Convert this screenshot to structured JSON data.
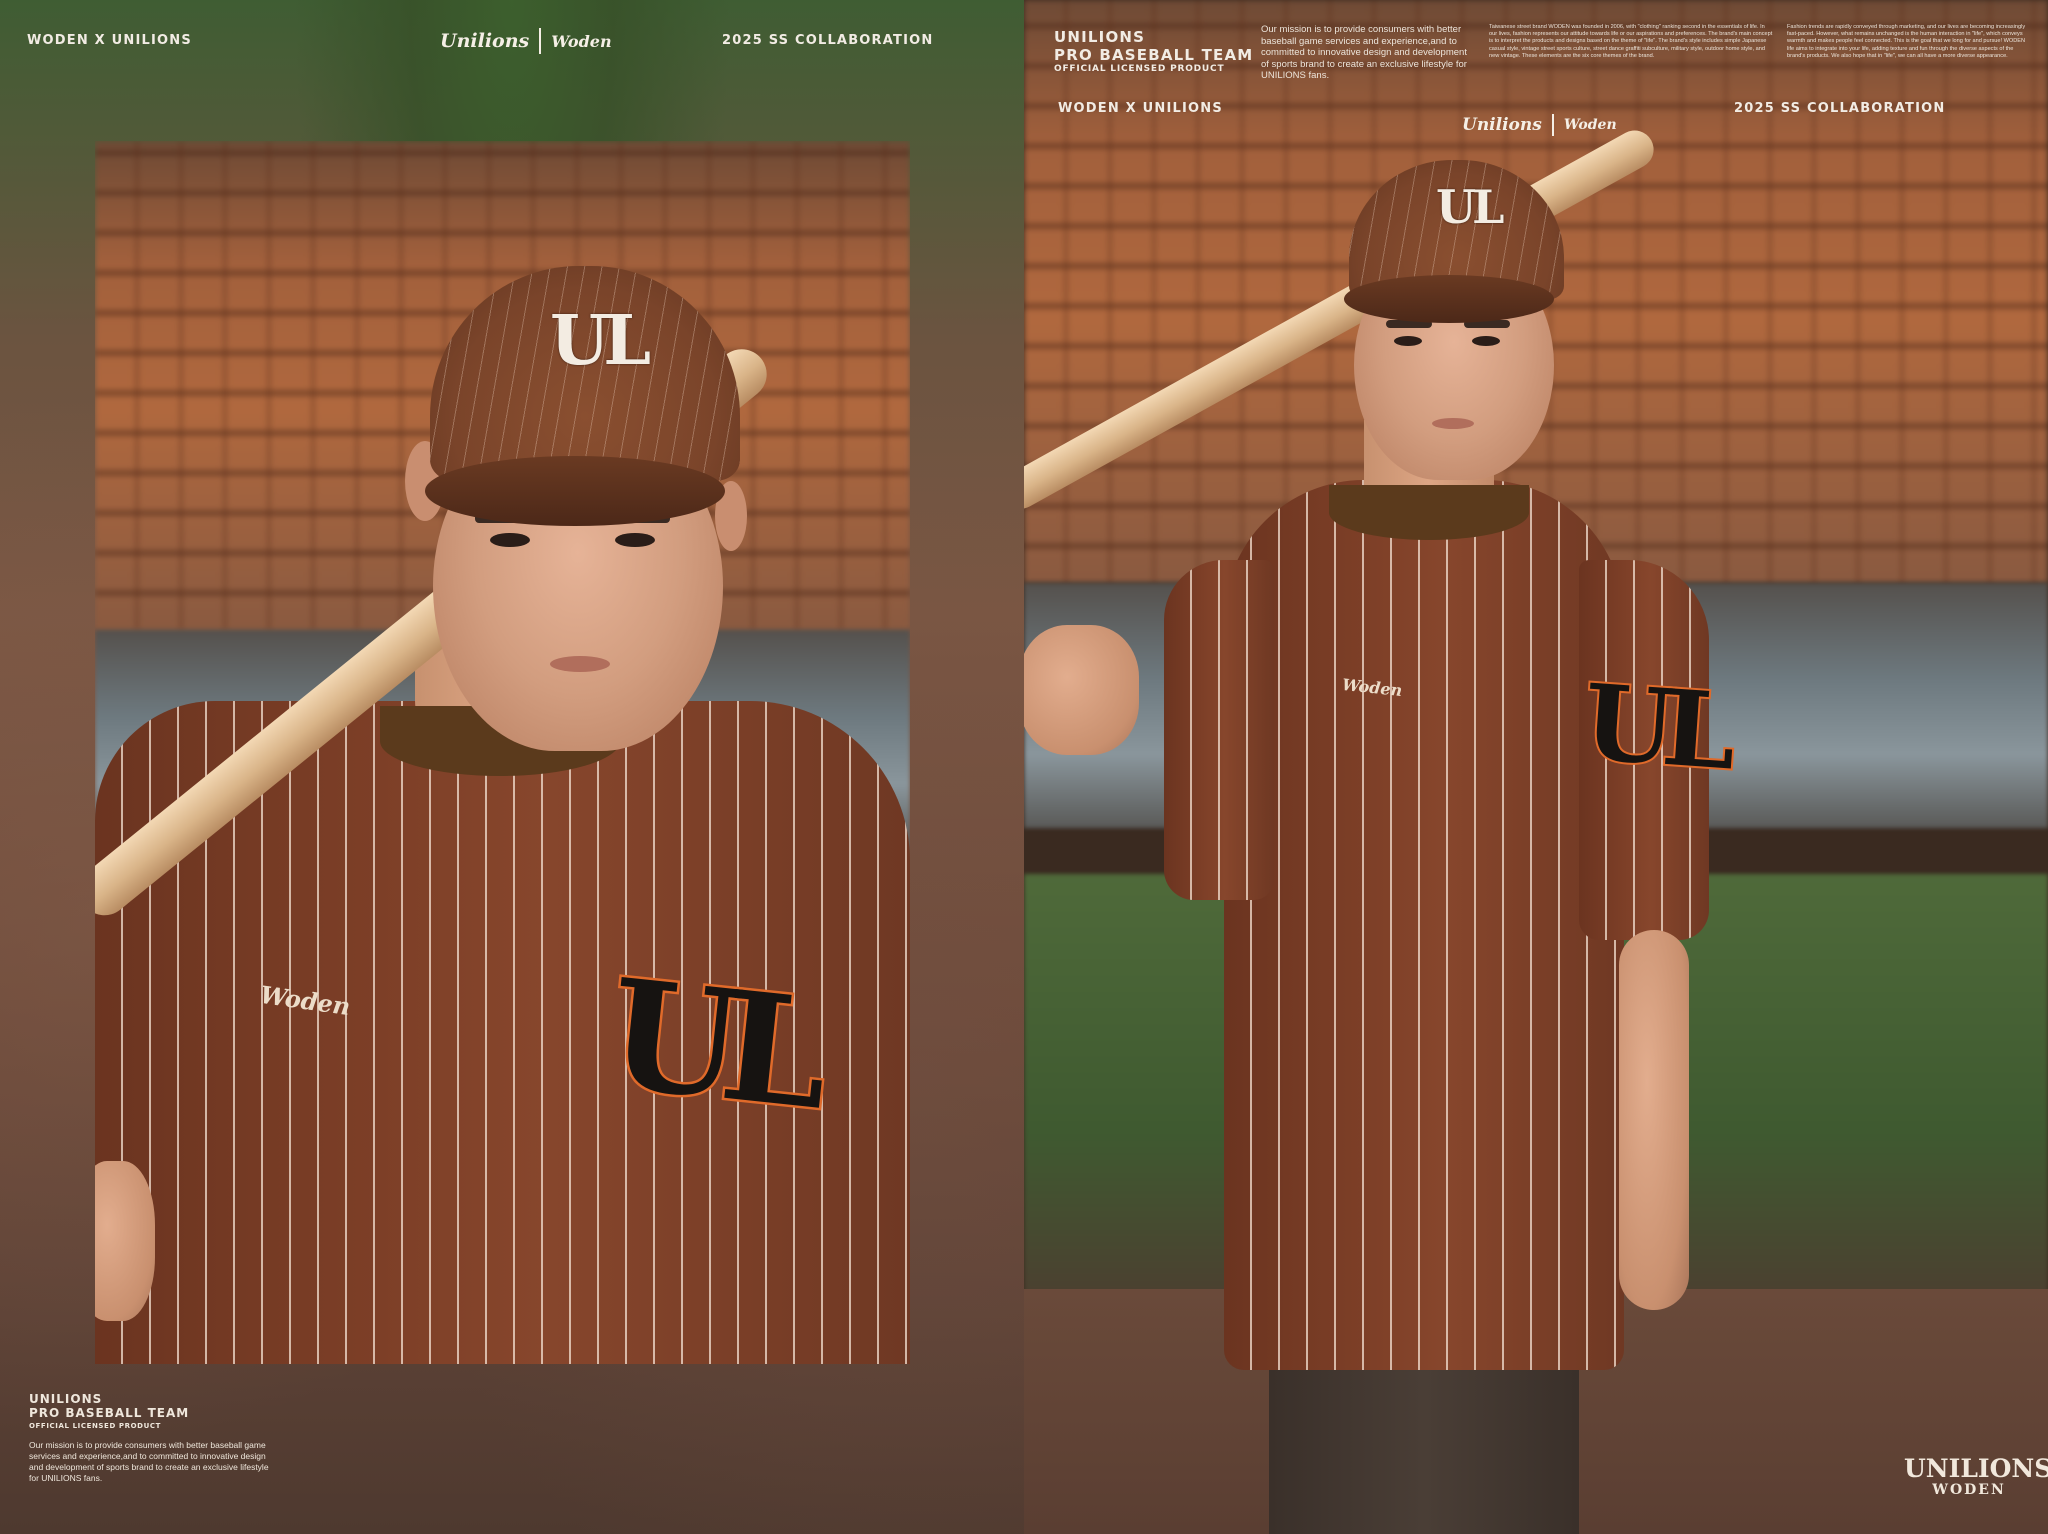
{
  "header": {
    "left": "WODEN X UNILIONS",
    "right": "2025 SS COLLABORATION",
    "logo_unilions": "Unilions",
    "logo_woden": "Woden"
  },
  "team": {
    "line1": "UNILIONS",
    "line2": "PRO BASEBALL TEAM",
    "line3": "OFFICIAL LICENSED PRODUCT"
  },
  "mission": "Our  mission is  to  provide consumers with better baseball game services  and  experience,and  to committed to innovative design and development of sports brand to  create an exclusive lifestyle for UNILIONS fans.",
  "col2": "Taiwanese street brand WODEN was founded in 2006, with \"clothing\" ranking second in the essentials of life. In our lives, fashion represents our attitude towards life or our aspirations and preferences. The brand's main concept is to interpret the products and designs based on the theme of \"life\". The brand's style includes simple Japanese casual style, vintage street sports culture, street dance graffiti subculture, military style, outdoor home style, and new vintage. These elements are the six core themes of the brand.",
  "col3": "Fashion trends are rapidly conveyed through marketing, and our lives are becoming increasingly fast-paced. However, what remains unchanged is the human interaction in \"life\", which conveys warmth and makes people feel connected. This is the goal that we long for and pursue! WODEN life aims to integrate into your life, adding texture and fun through the diverse aspects of the brand's products. We also hope that in \"life\", we can all have a more diverse appearance.",
  "cap_mark": "UL",
  "patch_mark": "UL",
  "chest_script": "Woden",
  "bottom_logo": {
    "top": "UNILIONS",
    "bottom": "WODEN"
  }
}
